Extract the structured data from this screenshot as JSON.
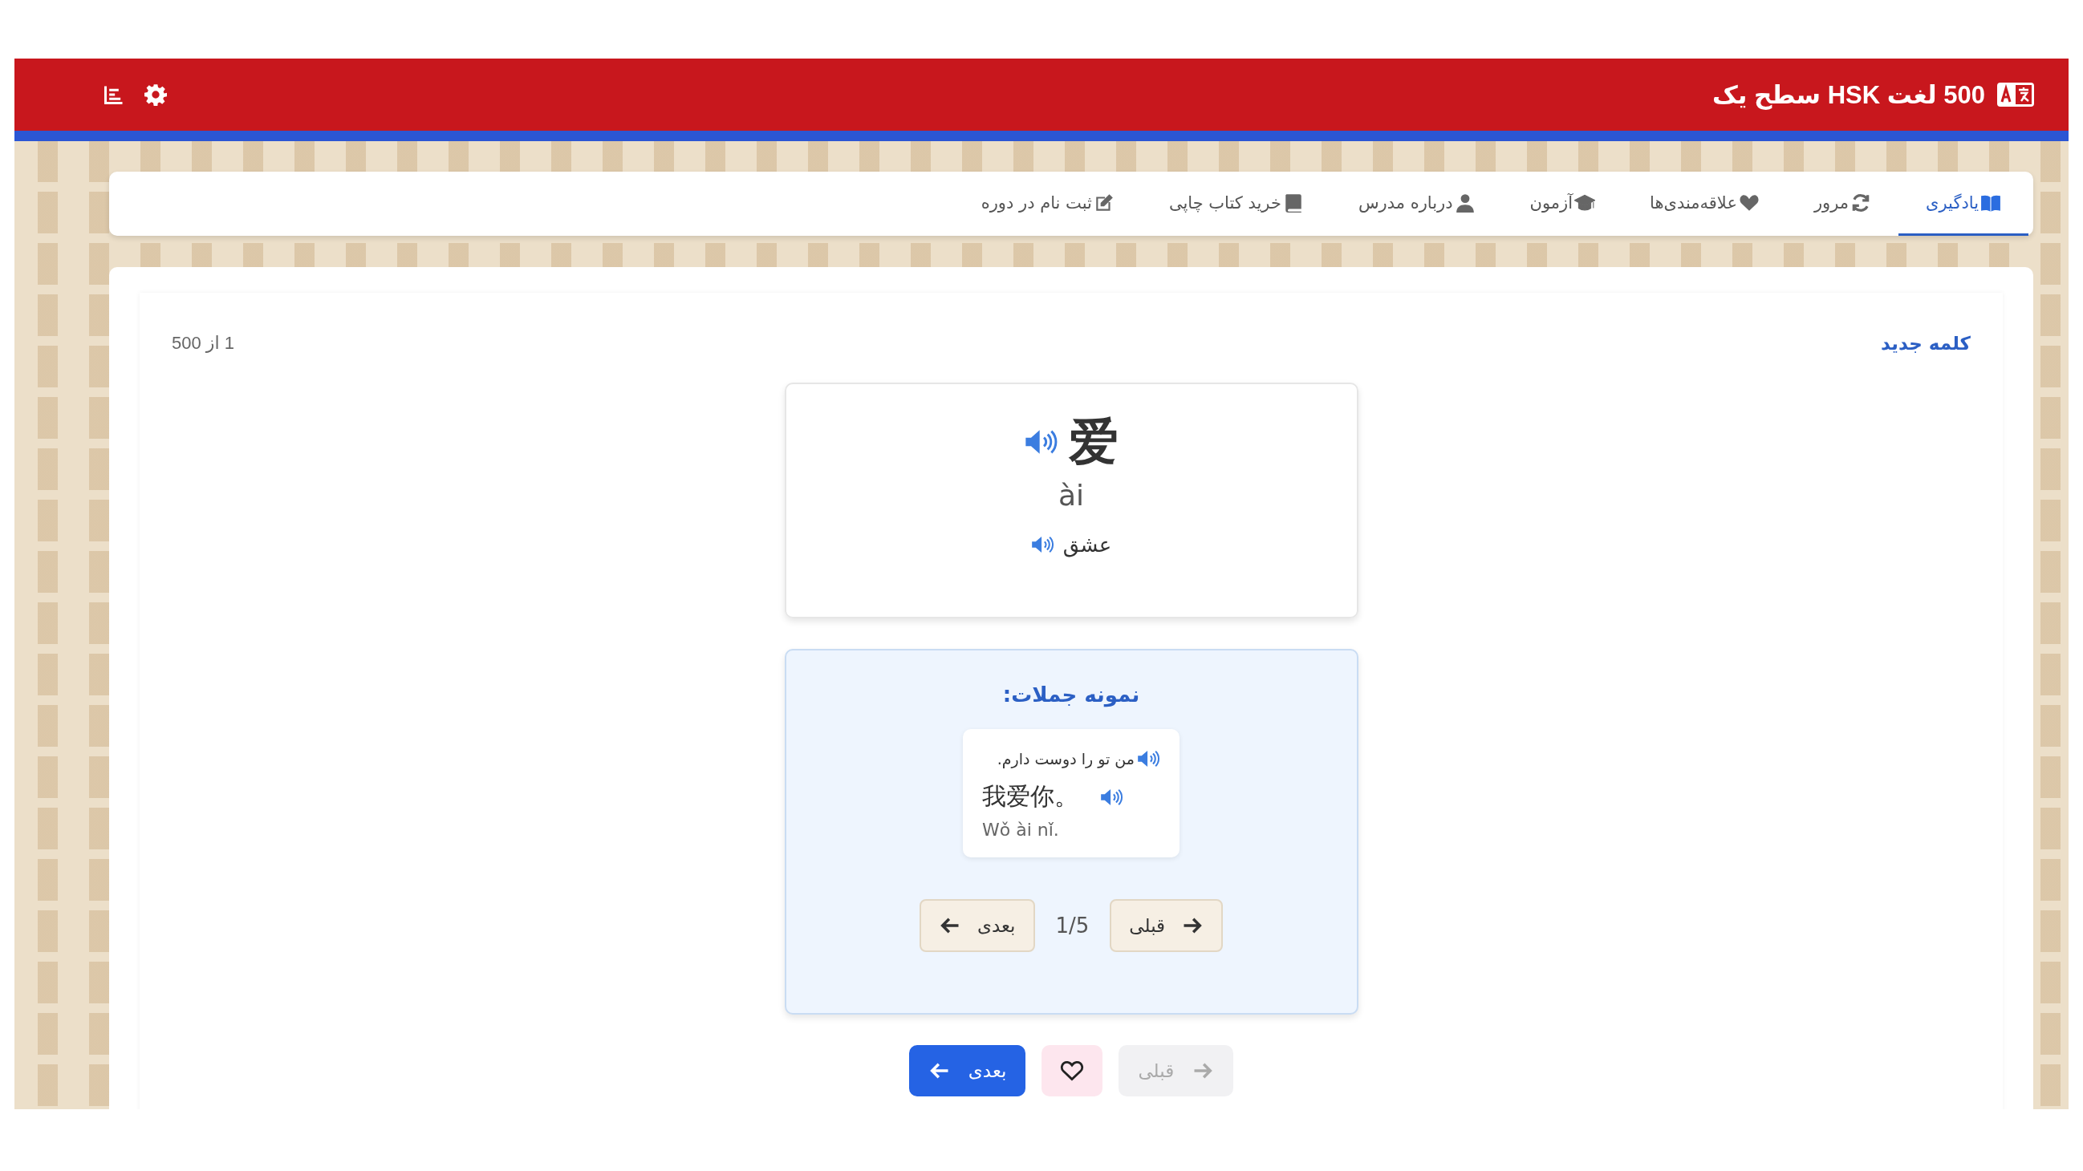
{
  "header": {
    "title": "500 لغت HSK سطح یک"
  },
  "tabs": [
    {
      "label": "یادگیری",
      "selected": true
    },
    {
      "label": "مرور",
      "selected": false
    },
    {
      "label": "علاقه‌مندی‌ها",
      "selected": false
    },
    {
      "label": "آزمون",
      "selected": false
    },
    {
      "label": "درباره مدرس",
      "selected": false
    },
    {
      "label": "خرید کتاب چاپی",
      "selected": false
    },
    {
      "label": "ثبت نام در دوره",
      "selected": false
    }
  ],
  "status": {
    "badge": "کلمه جدید",
    "progress": "1 از 500"
  },
  "word": {
    "hanzi": "爱",
    "pinyin": "ài",
    "meaning": "عشق"
  },
  "examples": {
    "title": "نمونه جملات:",
    "items": [
      {
        "translation": "من تو را دوست دارم.",
        "hanzi": "我爱你。",
        "pinyin": "Wǒ ài nǐ."
      }
    ],
    "counter": "1/5",
    "prev": {
      "label": "قبلی",
      "disabled": false
    },
    "next": {
      "label": "بعدی",
      "disabled": false
    }
  },
  "footer": {
    "prev": {
      "label": "قبلی",
      "disabled": true
    },
    "favorite": {
      "selected": false
    },
    "next": {
      "label": "بعدی",
      "disabled": false
    }
  }
}
